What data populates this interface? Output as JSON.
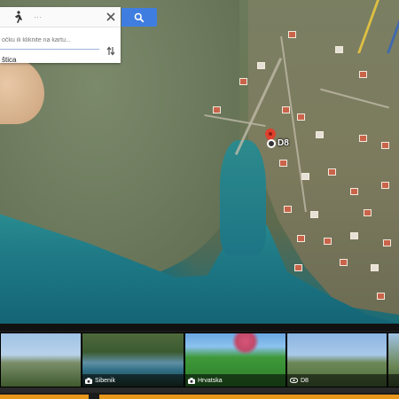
{
  "directions": {
    "mode_icon": "walk-icon",
    "from_placeholder": "očku ili kliknite na kartu...",
    "to_value": "štica",
    "swap_icon": "swap-icon",
    "close_icon": "close-icon"
  },
  "search": {
    "icon": "search-icon",
    "color": "#3f7ee0"
  },
  "map": {
    "marker_label": "D8",
    "marker_color": "#e0402e"
  },
  "photos": [
    {
      "caption": "",
      "icon": ""
    },
    {
      "caption": "Sibenik",
      "icon": "camera-icon"
    },
    {
      "caption": "Hrvatska",
      "icon": "camera-icon"
    },
    {
      "caption": "D8",
      "icon": "street-view-icon"
    },
    {
      "caption": "",
      "icon": ""
    }
  ],
  "colors": {
    "accent": "#e8961c",
    "sea": "#1f7a86"
  }
}
